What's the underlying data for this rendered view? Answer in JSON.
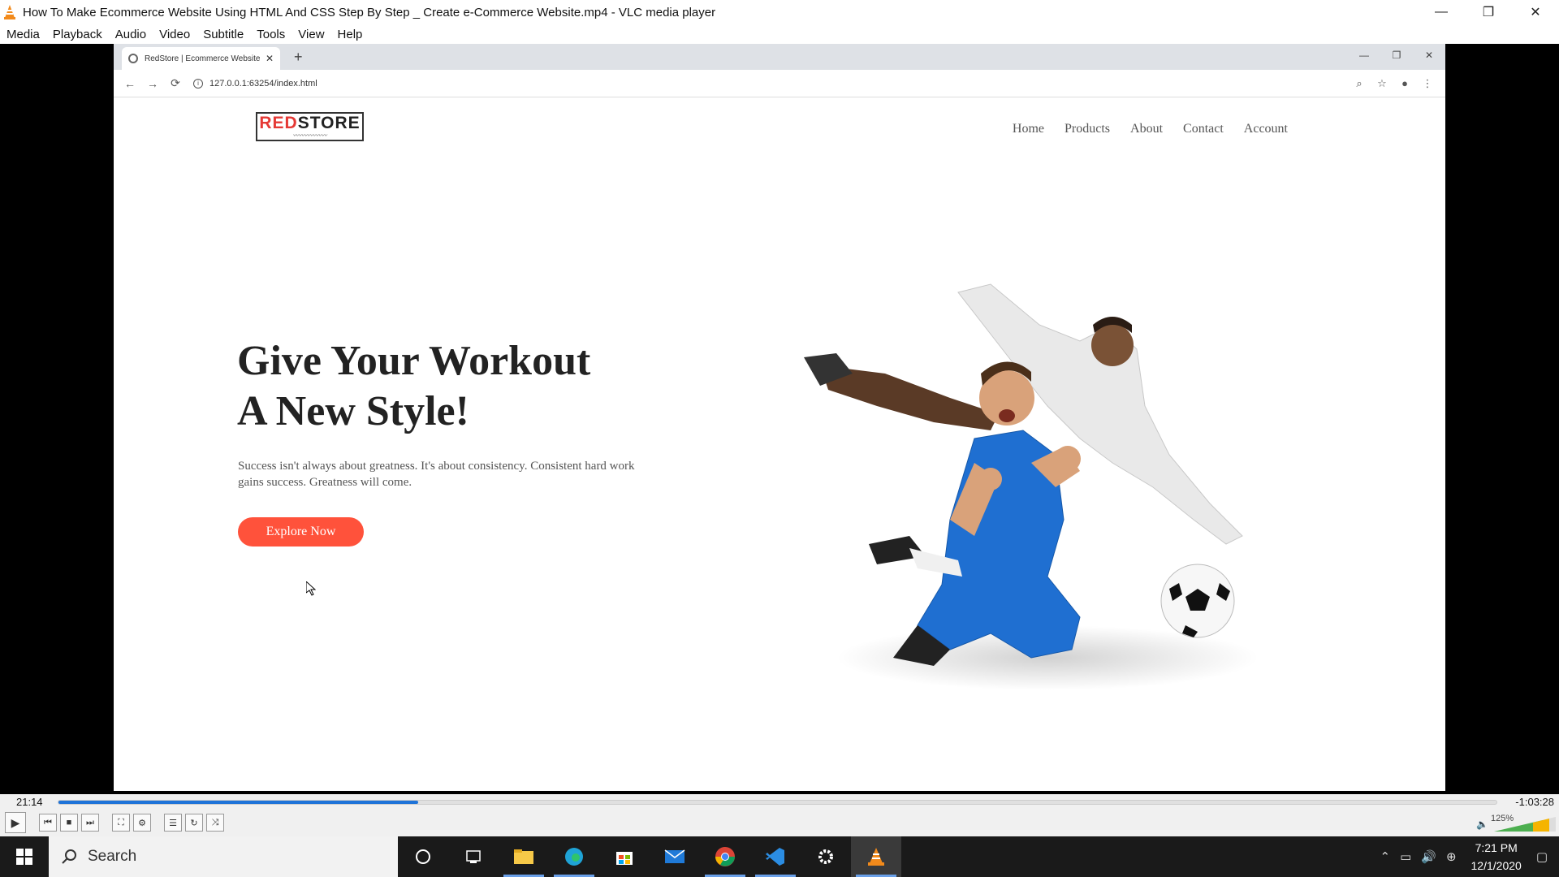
{
  "window": {
    "title": "How To Make Ecommerce Website Using HTML And CSS Step By Step _ Create e-Commerce Website.mp4 - VLC media player",
    "minimize": "—",
    "maximize": "❐",
    "close": "✕"
  },
  "menu": [
    "Media",
    "Playback",
    "Audio",
    "Video",
    "Subtitle",
    "Tools",
    "View",
    "Help"
  ],
  "browser": {
    "tab_title": "RedStore | Ecommerce Website",
    "tab_close": "✕",
    "new_tab": "+",
    "url": "127.0.0.1:63254/index.html",
    "back": "←",
    "forward": "→",
    "reload": "⟳"
  },
  "site": {
    "logo_red": "RED",
    "logo_dark": "STORE",
    "nav": [
      "Home",
      "Products",
      "About",
      "Contact",
      "Account"
    ],
    "headline_line1": "Give Your Workout",
    "headline_line2": "A New Style!",
    "subtext": "Success isn't always about greatness. It's about consistency. Consistent hard work gains success. Greatness will come.",
    "cta": "Explore Now"
  },
  "player": {
    "elapsed": "21:14",
    "remaining": "-1:03:28",
    "progress": 0.25,
    "volume": "125%"
  },
  "taskbar": {
    "search_placeholder": "Search",
    "time": "7:21 PM",
    "date": "12/1/2020"
  },
  "colors": {
    "accent_red": "#ff523b",
    "seek_blue": "#1e73d8"
  },
  "icons": [
    "vlc-icon",
    "search-icon",
    "cortana-icon",
    "task-view-icon",
    "file-explorer-icon",
    "edge-icon",
    "store-icon",
    "mail-icon",
    "chrome-icon",
    "vscode-icon",
    "settings-icon"
  ]
}
